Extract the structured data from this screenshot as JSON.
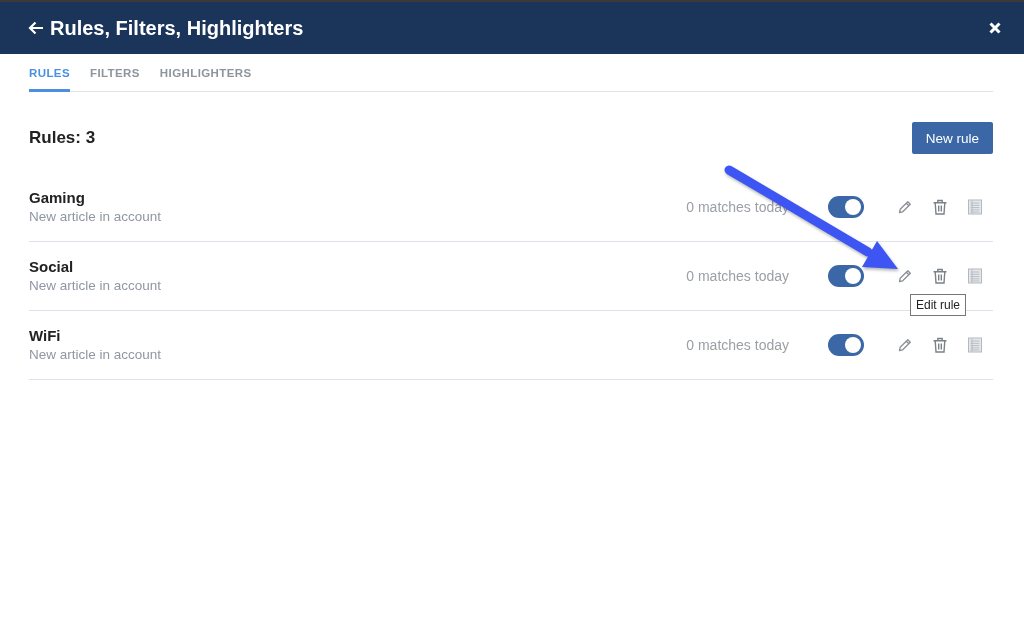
{
  "header": {
    "title": "Rules, Filters, Highlighters"
  },
  "tabs": [
    {
      "label": "RULES",
      "selected": true
    },
    {
      "label": "FILTERS",
      "selected": false
    },
    {
      "label": "HIGHLIGHTERS",
      "selected": false
    }
  ],
  "rules_header": {
    "count": "Rules: 3",
    "new_button": "New rule"
  },
  "rules": [
    {
      "name": "Gaming",
      "description": "New article in account",
      "matches": "0 matches today",
      "enabled": true
    },
    {
      "name": "Social",
      "description": "New article in account",
      "matches": "0 matches today",
      "enabled": true,
      "tooltip": "Edit rule"
    },
    {
      "name": "WiFi",
      "description": "New article in account",
      "matches": "0 matches today",
      "enabled": true
    }
  ]
}
